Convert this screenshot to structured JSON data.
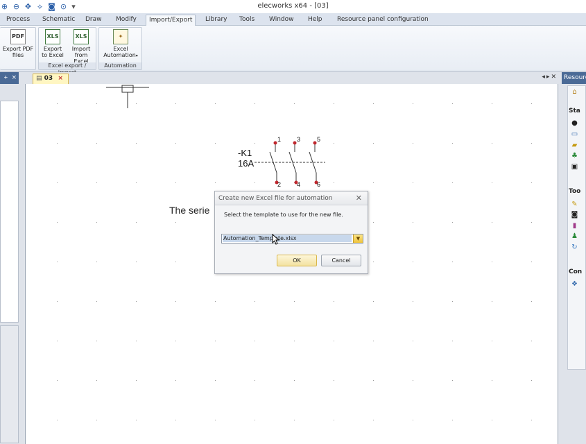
{
  "window": {
    "title": "elecworks x64 - [03]"
  },
  "ribbon_tabs": [
    {
      "label": "Process",
      "active": false
    },
    {
      "label": "Schematic",
      "active": false
    },
    {
      "label": "Draw",
      "active": false
    },
    {
      "label": "Modify",
      "active": false
    },
    {
      "label": "Import/Export",
      "active": true
    },
    {
      "label": "Library",
      "active": false
    },
    {
      "label": "Tools",
      "active": false
    },
    {
      "label": "Window",
      "active": false
    },
    {
      "label": "Help",
      "active": false
    },
    {
      "label": "Resource panel configuration",
      "active": false
    }
  ],
  "ribbon_groups": {
    "pdf": {
      "button": {
        "line1": "Export PDF",
        "line2": "files",
        "icon": "PDF"
      }
    },
    "excel": {
      "label": "Excel export / import",
      "export": {
        "line1": "Export",
        "line2": "to Excel",
        "icon": "XLS"
      },
      "import": {
        "line1": "Import",
        "line2": "from Excel",
        "icon": "XLS"
      }
    },
    "automation": {
      "label": "Automation",
      "button": {
        "line1": "Excel",
        "line2": "Automation",
        "icon": "automation-icon"
      }
    }
  },
  "document": {
    "tab_label": "03",
    "close_glyph": "×"
  },
  "drawing": {
    "component_ref": "-K1",
    "component_rating": "16A",
    "pins_top": [
      "1",
      "3",
      "5"
    ],
    "pins_bottom": [
      "2",
      "4",
      "6"
    ],
    "series_text": "The serie"
  },
  "right_panel": {
    "header": "Resource",
    "sections": [
      "Sta",
      "Too",
      "Con"
    ]
  },
  "dialog": {
    "title": "Create new Excel file for automation",
    "message": "Select the template to use for the new file.",
    "selected_template": "Automation_Template.xlsx",
    "ok_label": "OK",
    "cancel_label": "Cancel"
  },
  "colors": {
    "panel_header": "#4a6a96",
    "doc_tab": "#fff6c2",
    "pin_dot": "#c0272d",
    "dropdown_arrow": "#f0c43c"
  }
}
